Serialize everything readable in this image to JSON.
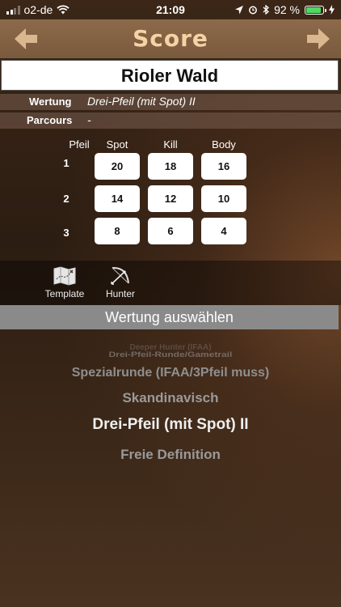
{
  "status": {
    "carrier": "o2-de",
    "time": "21:09",
    "battery": "92 %",
    "battery_level": 0.92
  },
  "header": {
    "title": "Score"
  },
  "course": {
    "name": "Rioler Wald",
    "wertung_label": "Wertung",
    "wertung_value": "Drei-Pfeil (mit Spot) II",
    "parcours_label": "Parcours",
    "parcours_value": "-"
  },
  "grid": {
    "row_header": "Pfeil",
    "columns": [
      "Spot",
      "Kill",
      "Body"
    ],
    "rows": [
      {
        "label": "1",
        "values": [
          "20",
          "18",
          "16"
        ]
      },
      {
        "label": "2",
        "values": [
          "14",
          "12",
          "10"
        ]
      },
      {
        "label": "3",
        "values": [
          "8",
          "6",
          "4"
        ]
      }
    ]
  },
  "toolbar": {
    "template_label": "Template",
    "hunter_label": "Hunter"
  },
  "picker": {
    "title": "Wertung auswählen",
    "items": [
      "Deeper Hunter (IFAA)",
      "Drei-Pfeil-Runde/Gametrail",
      "Spezialrunde (IFAA/3Pfeil muss)",
      "Skandinavisch",
      "Drei-Pfeil (mit Spot) II",
      "Freie Definition"
    ],
    "selected_index": 4
  }
}
